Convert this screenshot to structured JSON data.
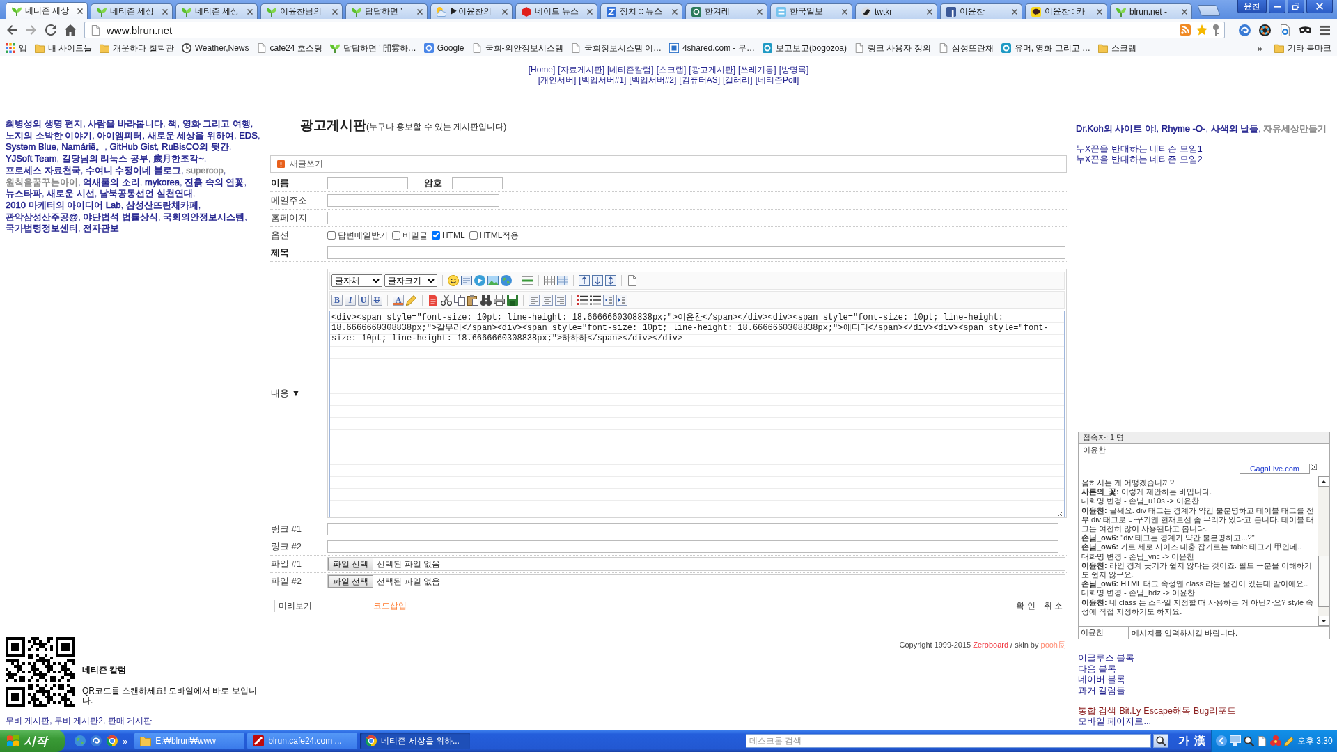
{
  "browser": {
    "tabs": [
      {
        "title": "네티즌 세상",
        "kind": "sprout",
        "selected": true
      },
      {
        "title": "네티즌 세상",
        "kind": "sprout",
        "selected": false
      },
      {
        "title": "네티즌 세상",
        "kind": "sprout",
        "selected": false
      },
      {
        "title": "이윤찬님의",
        "kind": "sprout",
        "selected": false
      },
      {
        "title": "답답하면 '",
        "kind": "sprout",
        "selected": false
      },
      {
        "title": "▶이윤찬의",
        "kind": "cloud",
        "selected": false
      },
      {
        "title": "네이트 뉴스",
        "kind": "hexagon",
        "selected": false
      },
      {
        "title": "정치 :: 뉴스",
        "kind": "zigzag",
        "selected": false
      },
      {
        "title": "한겨레",
        "kind": "badge",
        "selected": false
      },
      {
        "title": "한국일보",
        "kind": "tile",
        "selected": false
      },
      {
        "title": "twtkr",
        "kind": "bird",
        "selected": false
      },
      {
        "title": "이윤찬",
        "kind": "square",
        "selected": false
      },
      {
        "title": "이윤찬 : 카",
        "kind": "bubble",
        "selected": false
      },
      {
        "title": "blrun.net -",
        "kind": "sprout",
        "selected": false
      }
    ],
    "profile": "윤찬",
    "address": "www.blrun.net",
    "bookmarks": [
      {
        "label": "앱",
        "kind": "apps"
      },
      {
        "label": "내 사이트들",
        "kind": "folder"
      },
      {
        "label": "개운하다 철학관",
        "kind": "folder"
      },
      {
        "label": "Weather,News",
        "kind": "clock"
      },
      {
        "label": "cafe24 호스팅",
        "kind": "page"
      },
      {
        "label": "답답하면 ' 開雲하…",
        "kind": "sprout"
      },
      {
        "label": "Google",
        "kind": "google"
      },
      {
        "label": "국회-의안정보시스템",
        "kind": "page"
      },
      {
        "label": "국회정보시스템 이…",
        "kind": "page"
      },
      {
        "label": "4shared.com - 무…",
        "kind": "four"
      },
      {
        "label": "보고보고(bogozoa)",
        "kind": "ring"
      },
      {
        "label": "링크 사용자 정의",
        "kind": "page"
      },
      {
        "label": "삼성뜨란채",
        "kind": "page"
      },
      {
        "label": "유머, 영화 그리고 …",
        "kind": "ring"
      },
      {
        "label": "스크랩",
        "kind": "folder"
      }
    ],
    "more": "»",
    "other_bookmarks": "기타 북마크"
  },
  "page": {
    "nav": [
      [
        "[Home]",
        "[자료게시판]",
        "[네티즌칼럼]",
        "[스크랩]",
        "[광고게시판]",
        "[쓰레기통]",
        "[방명록]"
      ],
      [
        "[개인서버]",
        "[백업서버#1]",
        "[백업서버#2]",
        "[컴퓨터AS]",
        "[갤러리]",
        "[네티즌Poll]"
      ]
    ],
    "left": {
      "blogroll": {
        "separator": ", ",
        "links": [
          {
            "label": "최병성의 생명 편지",
            "color": "#1e1e8c"
          },
          {
            "label": "사람을 바라봅니다",
            "color": "#1e1e8c"
          },
          {
            "label": "책, 영화 그리고 여행",
            "color": "#1e1e8c"
          },
          {
            "label": "노지의 소박한 이야기",
            "color": "#1e1e8c"
          },
          {
            "label": "아이엠피터",
            "color": "#1e1e8c"
          },
          {
            "label": "새로운 세상을 위하여",
            "color": "#1e1e8c"
          },
          {
            "label": "EDS",
            "color": "#1e1e8c"
          },
          {
            "label": "System Blue",
            "color": "#1e1e8c"
          },
          {
            "label": "Namárië。",
            "color": "#1e1e8c"
          },
          {
            "label": "GitHub Gist",
            "color": "#1e1e8c"
          },
          {
            "label": "RuBisCO의 뒷간",
            "color": "#1e1e8c"
          },
          {
            "label": "YJSoft Team",
            "color": "#1e1e8c"
          },
          {
            "label": "길당님의 리눅스 공부",
            "color": "#1e1e8c"
          },
          {
            "label": "歲月한조각~",
            "color": "#1e1e8c"
          },
          {
            "label": "프로세스 자료천국",
            "color": "#1e1e8c"
          },
          {
            "label": "수여니 수정이네 블로그",
            "color": "#1e1e8c"
          },
          {
            "label": "supercop",
            "color": "#888888"
          },
          {
            "label": "원칙을꿈꾸는아이",
            "color": "#888888"
          },
          {
            "label": "억새풀의 소리",
            "color": "#1e1e8c"
          },
          {
            "label": "mykorea",
            "color": "#1e1e8c"
          },
          {
            "label": "진흙 속의 연꽃",
            "color": "#1e1e8c"
          },
          {
            "label": "뉴스타파",
            "color": "#1e1e8c"
          },
          {
            "label": "새로운 시선",
            "color": "#1e1e8c"
          },
          {
            "label": "남북공동선언 실천연대",
            "color": "#1e1e8c"
          },
          {
            "label": "2010 마케터의 아이디어 Lab",
            "color": "#1e1e8c"
          },
          {
            "label": "삼성산뜨란채카페",
            "color": "#1e1e8c"
          },
          {
            "label": "관악삼성산주공@",
            "color": "#1e1e8c"
          },
          {
            "label": "야단법석 법률상식",
            "color": "#1e1e8c"
          },
          {
            "label": "국회의안정보시스템",
            "color": "#1e1e8c"
          },
          {
            "label": "국가법령정보센터",
            "color": "#1e1e8c"
          },
          {
            "label": "전자관보",
            "color": "#1e1e8c"
          }
        ]
      },
      "qr_title": "네티즌 칼럼",
      "qr_caption": "QR코드를 스캔하세요! 모바일에서 바로 보입니다.",
      "boards": {
        "separator": ", ",
        "links": [
          "무비 게시판",
          "무비 게시판2",
          "판매 게시판"
        ]
      }
    },
    "board": {
      "title": "광고게시판",
      "subtitle": "(누구나 홍보할 수 있는 게시판입니다)",
      "form_title": "새글쓰기",
      "name_label": "이름",
      "password_label": "암호",
      "email_label": "메일주소",
      "homepage_label": "홈페이지",
      "options_label": "옵션",
      "options": [
        {
          "label": "답변메일받기",
          "checked": false
        },
        {
          "label": "비밀글",
          "checked": false
        },
        {
          "label": "HTML",
          "checked": true
        },
        {
          "label": "HTML적용",
          "checked": false
        }
      ],
      "subject_label": "제목",
      "editor": {
        "label": "내용 ▼",
        "font": "글자체",
        "size": "글자크기",
        "format_buttons": [
          "B",
          "I",
          "U",
          "U"
        ],
        "color_button": "A",
        "content": "<div><span style=\"font-size: 10pt; line-height: 18.6666660308838px;\">이윤찬</span></div><div><span style=\"font-size: 10pt; line-height: 18.6666660308838px;\">갈무리</span><div><span style=\"font-size: 10pt; line-height: 18.6666660308838px;\">에디터</span></div><div><span style=\"font-size: 10pt; line-height: 18.6666660308838px;\">하하하</span></div></div>"
      },
      "link_fields": [
        "링크 #1",
        "링크 #2"
      ],
      "file_fields": [
        {
          "label": "파일 #1",
          "button": "파일 선택",
          "status": "선택된 파일 없음"
        },
        {
          "label": "파일 #2",
          "button": "파일 선택",
          "status": "선택된 파일 없음"
        }
      ],
      "preview": "미리보기",
      "code_insert": "코드삽입",
      "confirm": "확 인",
      "cancel": "취 소"
    },
    "copyright": {
      "text": "Copyright 1999-2015",
      "engine": "Zeroboard",
      "by": "/ skin by",
      "author": "pooh長"
    },
    "right": {
      "blogroll": {
        "separator": ", ",
        "links": [
          {
            "label": "Dr.Koh의 사이트 야!",
            "color": "#1e1e8c"
          },
          {
            "label": "Rhyme -O-",
            "color": "#1e1e8c"
          },
          {
            "label": "사색의 날들",
            "color": "#1e1e8c"
          },
          {
            "label": "자유세상만들기",
            "color": "#888888"
          }
        ]
      },
      "cafes": [
        "누X꾼을 반대하는 네티즌 모임1",
        "누X꾼을 반대하는 네티즌 모임2"
      ],
      "chat": {
        "header": "접속자: 1 명",
        "users": [
          "이윤찬"
        ],
        "badge": "GagaLive.com",
        "messages": [
          "음하시는 게 어떻겠습니까?",
          "**사론의_꽃:** 이렇게 제안하는 바입니다.",
          "대화명 변경 - 손님_u10s -> 이윤찬",
          "**이윤찬:** 글쎄요. div 태그는 경계가 약간 불분명하고 테이블 태그를 전부 div 태그로 바꾸기엔 현재로선 좀 무리가 있다고 봅니다. 테이블 태그는 여전히 많이 사용된다고 봅니다.",
          "**손님_ow6:** \"div 태그는 경계가 약간 불분명하고...?\"",
          "**손님_ow6:** 가로 세로 사이즈 대충 잡기로는 table 태그가 甲인데..",
          "대화명 변경 - 손님_vnc -> 이윤찬",
          "**이윤찬:** 라인 경계 긋기가 쉽지 않다는 것이죠. 필드 구분을 이해하기도 쉽지 않구요.",
          "**손님_ow6:** HTML 태그 속성엔 class 라는 물건이 있는데 말이에요..",
          "대화명 변경 - 손님_hdz -> 이윤찬",
          "**이윤찬:** 네 class 는 스타일 지정할 때 사용하는 거 아닌가요? style 속성에 직접 지정하기도 하지요."
        ],
        "nickname": "이윤찬",
        "placeholder": "메시지를 입력하시길 바랍니다."
      },
      "blogs": [
        "이글루스 블록",
        "다음 블록",
        "네이버 블록",
        "과거 칼럼들"
      ],
      "tools": [
        "통합 검색",
        "Bit.Ly",
        "Escape해독",
        "Bug리포트"
      ],
      "mobile": "모바일 페이지로..."
    }
  },
  "taskbar": {
    "start": "시작",
    "more": "»",
    "tasks": [
      {
        "label": "E:₩blrun₩www",
        "kind": "folder",
        "selected": false
      },
      {
        "label": "blrun.cafe24.com ...",
        "kind": "ftp",
        "selected": false
      },
      {
        "label": "네티즌 세상을 위하...",
        "kind": "browser",
        "selected": true
      }
    ],
    "search_placeholder": "데스크톱 검색",
    "ime": [
      "가",
      "漢"
    ],
    "clock": "오후 3:30"
  }
}
